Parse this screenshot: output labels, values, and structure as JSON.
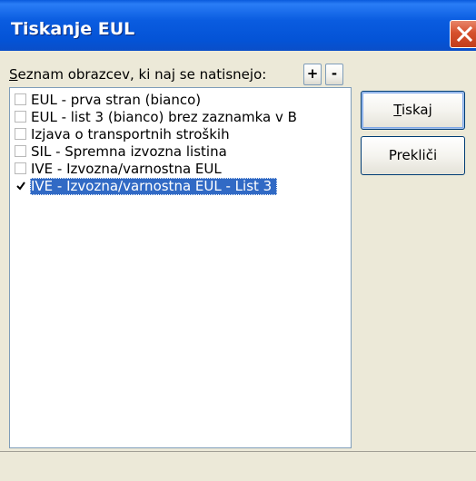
{
  "window": {
    "title": "Tiskanje EUL"
  },
  "list": {
    "label_underlined": "S",
    "label_rest": "eznam obrazcev, ki naj se natisnejo:",
    "add_label": "+",
    "remove_label": "-",
    "items": [
      {
        "label": "EUL - prva stran (bianco)",
        "checked": false,
        "selected": false
      },
      {
        "label": "EUL - list 3 (bianco) brez zaznamka v B",
        "checked": false,
        "selected": false
      },
      {
        "label": "Izjava o transportnih stroških",
        "checked": false,
        "selected": false
      },
      {
        "label": "SIL - Spremna izvozna listina",
        "checked": false,
        "selected": false
      },
      {
        "label": "IVE - Izvozna/varnostna EUL",
        "checked": false,
        "selected": false
      },
      {
        "label": "IVE - Izvozna/varnostna EUL - List 3",
        "checked": true,
        "selected": true
      }
    ]
  },
  "buttons": {
    "print_underlined": "T",
    "print_rest": "iskaj",
    "cancel_label": "Prekliči"
  },
  "colors": {
    "selection": "#316ac5",
    "titlebar": "#0a5ce0",
    "close": "#d6512e"
  }
}
